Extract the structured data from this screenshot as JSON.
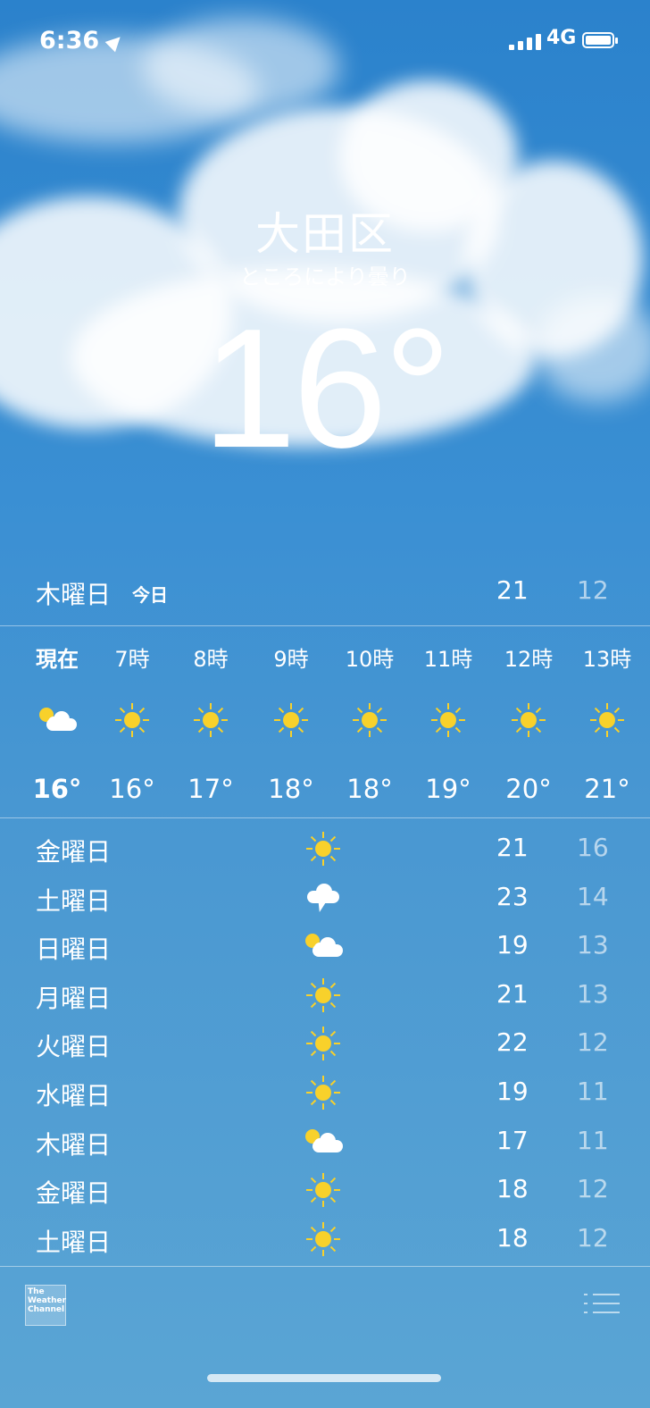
{
  "status_bar": {
    "time": "6:36",
    "network": "4G"
  },
  "location": {
    "city": "大田区",
    "condition": "ところにより曇り",
    "temperature": "16°"
  },
  "today": {
    "day": "木曜日",
    "tag": "今日",
    "high": "21",
    "low": "12"
  },
  "hourly": [
    {
      "label": "現在",
      "icon": "partly-cloudy-icon",
      "temp": "16°"
    },
    {
      "label": "7時",
      "icon": "sun-icon",
      "temp": "16°"
    },
    {
      "label": "8時",
      "icon": "sun-icon",
      "temp": "17°"
    },
    {
      "label": "9時",
      "icon": "sun-icon",
      "temp": "18°"
    },
    {
      "label": "10時",
      "icon": "sun-icon",
      "temp": "18°"
    },
    {
      "label": "11時",
      "icon": "sun-icon",
      "temp": "19°"
    },
    {
      "label": "12時",
      "icon": "sun-icon",
      "temp": "20°"
    },
    {
      "label": "13時",
      "icon": "sun-icon",
      "temp": "21°"
    }
  ],
  "daily": [
    {
      "day": "金曜日",
      "icon": "sun-icon",
      "high": "21",
      "low": "16"
    },
    {
      "day": "土曜日",
      "icon": "thunderstorm-icon",
      "high": "23",
      "low": "14"
    },
    {
      "day": "日曜日",
      "icon": "partly-cloudy-icon",
      "high": "19",
      "low": "13"
    },
    {
      "day": "月曜日",
      "icon": "sun-icon",
      "high": "21",
      "low": "13"
    },
    {
      "day": "火曜日",
      "icon": "sun-icon",
      "high": "22",
      "low": "12"
    },
    {
      "day": "水曜日",
      "icon": "sun-icon",
      "high": "19",
      "low": "11"
    },
    {
      "day": "木曜日",
      "icon": "partly-cloudy-icon",
      "high": "17",
      "low": "11"
    },
    {
      "day": "金曜日",
      "icon": "sun-icon",
      "high": "18",
      "low": "12"
    },
    {
      "day": "土曜日",
      "icon": "sun-icon",
      "high": "18",
      "low": "12"
    }
  ],
  "footer": {
    "provider": "The Weather Channel"
  },
  "colors": {
    "sun": "#f8d12b",
    "sky_top": "#2b82cc",
    "sky_bottom": "#5aa5d4"
  }
}
